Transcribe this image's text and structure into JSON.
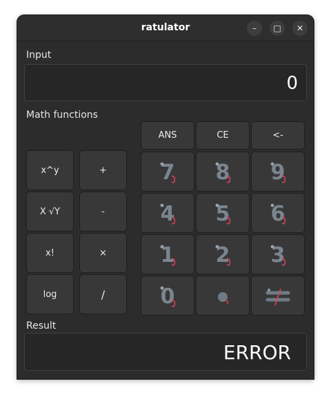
{
  "window": {
    "title": "ratulator"
  },
  "titlebar": {
    "minimize": "–",
    "maximize": "□",
    "close": "✕"
  },
  "input": {
    "label": "Input",
    "value": "0"
  },
  "math": {
    "label": "Math functions",
    "buttons": [
      "x^y",
      "+",
      "X √Y",
      "-",
      "x!",
      "×",
      "log",
      "/"
    ]
  },
  "top_buttons": [
    "ANS",
    "CE",
    "<-"
  ],
  "digits": [
    "7",
    "8",
    "9",
    "4",
    "5",
    "6",
    "1",
    "2",
    "3",
    "0"
  ],
  "result": {
    "label": "Result",
    "value": "ERROR"
  },
  "colors": {
    "digit": "#7b8590",
    "tail": "#e0425a",
    "accent_bg": "#2c2c2c"
  }
}
